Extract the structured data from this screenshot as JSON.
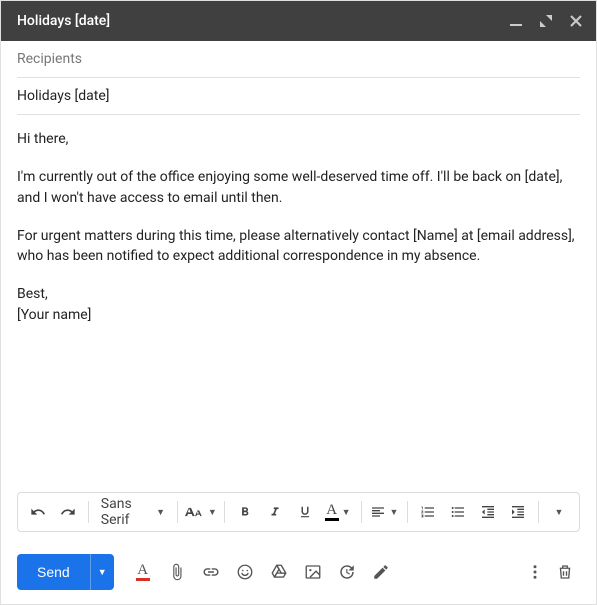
{
  "titlebar": {
    "title": "Holidays [date]"
  },
  "fields": {
    "recipients_placeholder": "Recipients",
    "subject": "Holidays [date]"
  },
  "body": {
    "greeting": "Hi there,",
    "p1": "I'm currently out of the office enjoying some well-deserved time off. I'll be back on [date], and I won't have access to email until then.",
    "p2": "For urgent matters during this time, please alternatively contact [Name] at [email address], who has been notified to expect additional correspondence in my absence.",
    "signoff": "Best,",
    "name": "[Your name]"
  },
  "format_toolbar": {
    "font_family": "Sans Serif"
  },
  "bottombar": {
    "send_label": "Send"
  }
}
